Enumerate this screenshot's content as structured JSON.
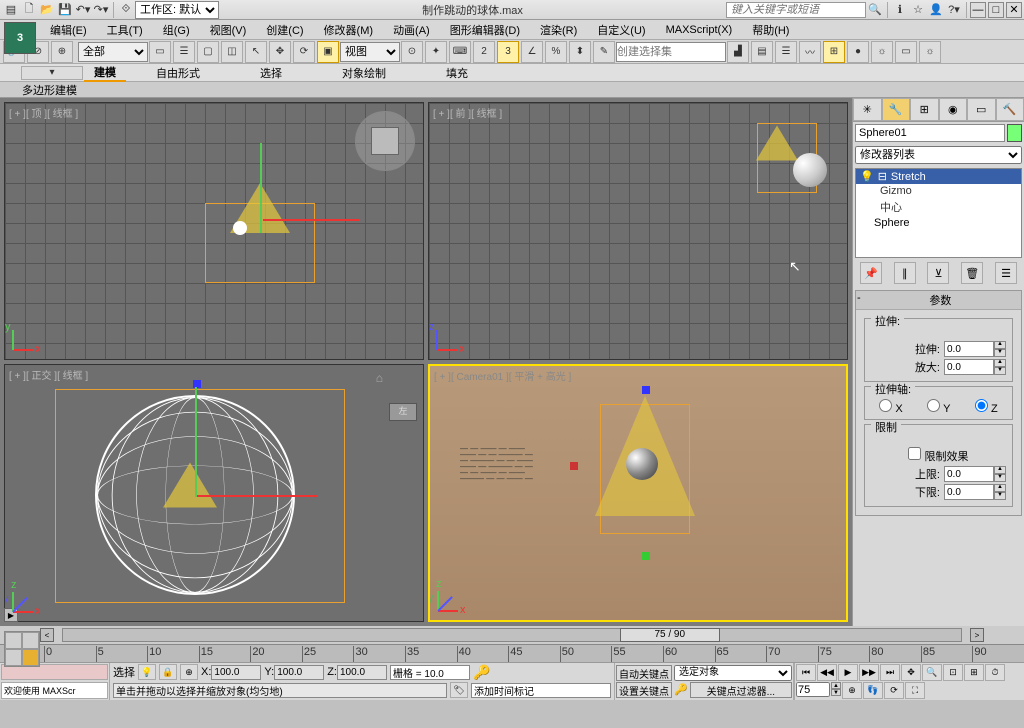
{
  "title": {
    "workspace_label": "工作区: 默认",
    "filename": "制作跳动的球体.max",
    "search_placeholder": "键入关键字或短语"
  },
  "menu": {
    "edit": "编辑(E)",
    "tools": "工具(T)",
    "group": "组(G)",
    "views": "视图(V)",
    "create": "创建(C)",
    "modifiers": "修改器(M)",
    "animation": "动画(A)",
    "grapheditors": "图形编辑器(D)",
    "rendering": "渲染(R)",
    "customize": "自定义(U)",
    "maxscript": "MAXScript(X)",
    "help": "帮助(H)"
  },
  "toolbar": {
    "all": "全部",
    "view": "视图",
    "selset": "创建选择集"
  },
  "ribbon": {
    "modeling": "建模",
    "freeform": "自由形式",
    "selection": "选择",
    "objectpaint": "对象绘制",
    "populate": "填充",
    "polymodel": "多边形建模"
  },
  "viewports": {
    "top": "[ + ][ 顶 ][ 线框 ]",
    "front": "[ + ][ 前 ][ 线框 ]",
    "ortho": "[ + ][ 正交 ][ 线框 ]",
    "camera": "[ + ][ Camera01 ][ 平滑 + 高光 ]",
    "persp_cube": "左"
  },
  "cmdpanel": {
    "objname": "Sphere01",
    "modlist_label": "修改器列表",
    "stack": {
      "stretch": "Stretch",
      "gizmo": "Gizmo",
      "center": "中心",
      "sphere": "Sphere"
    },
    "params": {
      "title": "参数",
      "stretch_group": "拉伸:",
      "stretch": "拉伸:",
      "stretch_val": "0.0",
      "amplify": "放大:",
      "amplify_val": "0.0",
      "axis_group": "拉伸轴:",
      "axis_x": "X",
      "axis_y": "Y",
      "axis_z": "Z",
      "limit_group": "限制",
      "limit_effect": "限制效果",
      "upper": "上限:",
      "upper_val": "0.0",
      "lower": "下限:",
      "lower_val": "0.0"
    }
  },
  "timeslider": {
    "pos": "75 / 90"
  },
  "timeline": {
    "ticks": [
      "0",
      "5",
      "10",
      "15",
      "20",
      "25",
      "30",
      "35",
      "40",
      "45",
      "50",
      "55",
      "60",
      "65",
      "70",
      "75",
      "80",
      "85",
      "90"
    ]
  },
  "status": {
    "welcome": "欢迎使用 MAXScr",
    "select_label": "选择",
    "x": "X:",
    "x_val": "100.0",
    "y": "Y:",
    "y_val": "100.0",
    "z": "Z:",
    "z_val": "100.0",
    "grid": "栅格 = 10.0",
    "hint": "单击并拖动以选择并缩放对象(均匀地)",
    "addtime": "添加时间标记",
    "autokey": "自动关键点",
    "setkey": "设置关键点",
    "selected": "选定对象",
    "keyfilter": "关键点过滤器...",
    "frame": "75"
  }
}
